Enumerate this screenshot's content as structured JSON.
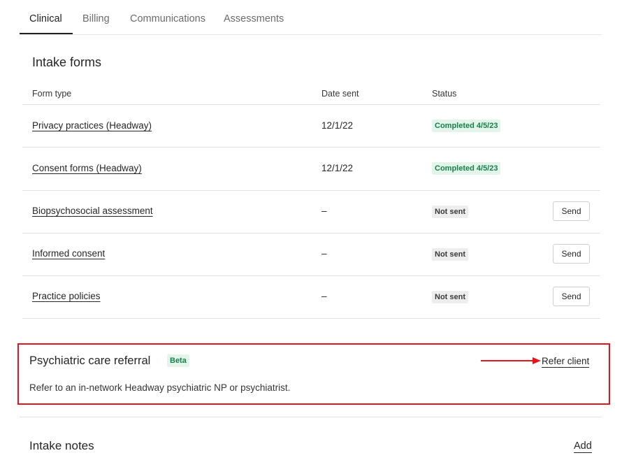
{
  "tabs": [
    {
      "label": "Clinical"
    },
    {
      "label": "Billing"
    },
    {
      "label": "Communications"
    },
    {
      "label": "Assessments"
    }
  ],
  "intake_forms": {
    "title": "Intake forms",
    "columns": {
      "form_type": "Form type",
      "date_sent": "Date sent",
      "status": "Status"
    },
    "rows": [
      {
        "form": "Privacy practices (Headway)",
        "date": "12/1/22",
        "status": "Completed 4/5/23"
      },
      {
        "form": "Consent forms (Headway)",
        "date": "12/1/22",
        "status": "Completed 4/5/23"
      },
      {
        "form": "Biopsychosocial assessment",
        "date": "–",
        "status": "Not sent",
        "action": "Send"
      },
      {
        "form": "Informed consent",
        "date": "–",
        "status": "Not sent",
        "action": "Send"
      },
      {
        "form": "Practice policies",
        "date": "–",
        "status": "Not sent",
        "action": "Send"
      }
    ]
  },
  "referral": {
    "title": "Psychiatric care referral",
    "badge": "Beta",
    "description": "Refer to an in-network Headway psychiatric NP or psychiatrist.",
    "action": "Refer client"
  },
  "intake_notes": {
    "title": "Intake notes",
    "action": "Add"
  },
  "colors": {
    "highlight_border": "#e4161d",
    "completed_bg": "#e3f5ea",
    "completed_text": "#17804a",
    "not_sent_bg": "#ededed"
  }
}
